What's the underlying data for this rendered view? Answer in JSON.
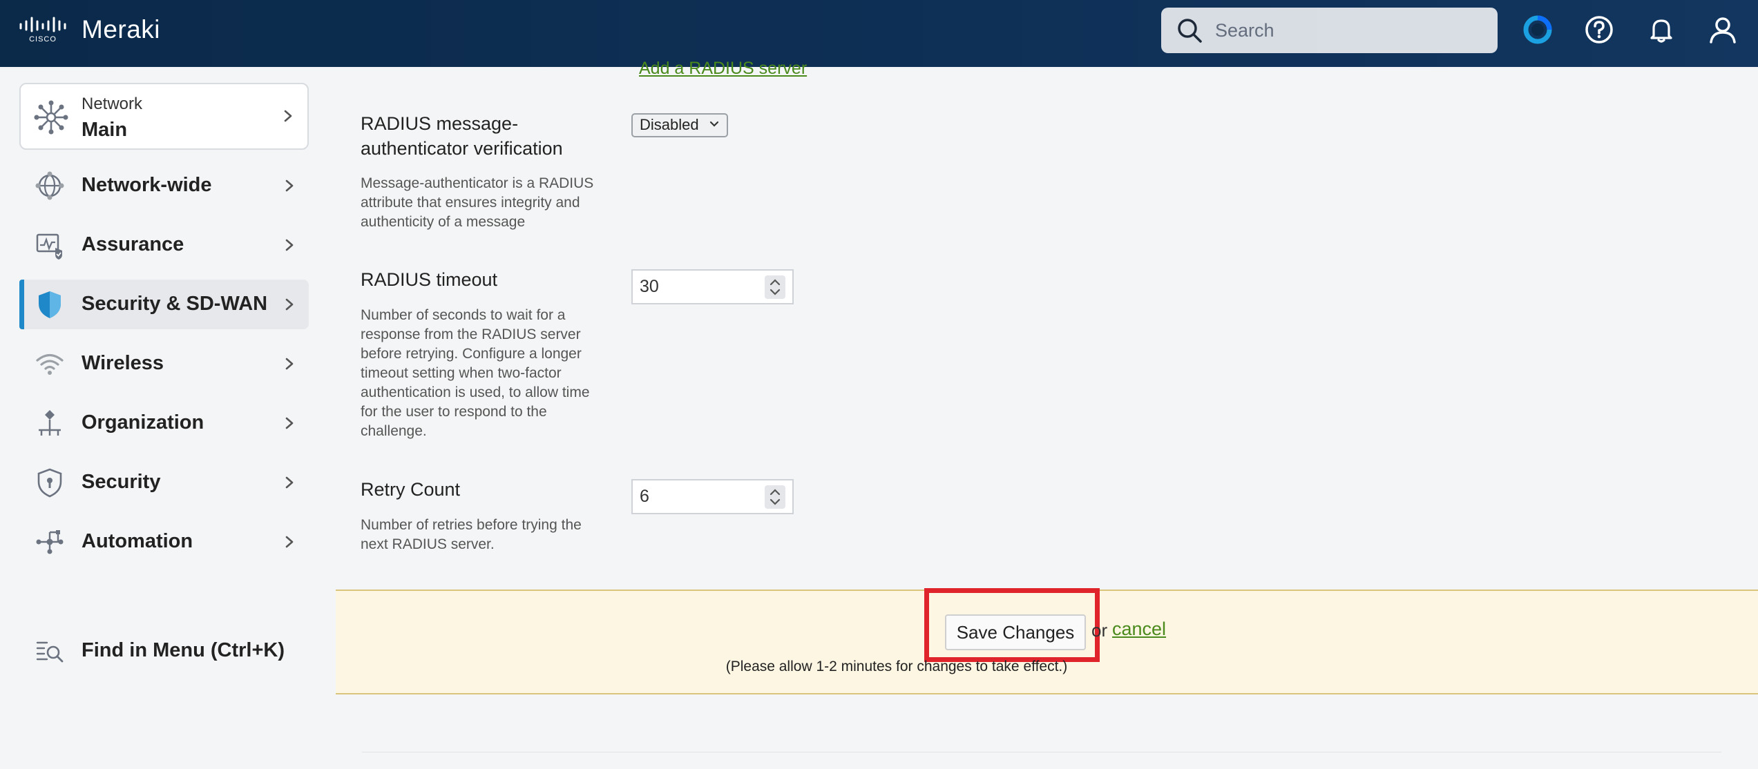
{
  "header": {
    "brand": "Meraki",
    "search_placeholder": "Search"
  },
  "sidebar": {
    "network_label": "Network",
    "network_name": "Main",
    "items": [
      {
        "label": "Network-wide"
      },
      {
        "label": "Assurance"
      },
      {
        "label": "Security & SD-WAN"
      },
      {
        "label": "Wireless"
      },
      {
        "label": "Organization"
      },
      {
        "label": "Security"
      },
      {
        "label": "Automation"
      }
    ],
    "find_menu": "Find in Menu (Ctrl+K)"
  },
  "content": {
    "add_radius_link": "Add a RADIUS server",
    "msg_auth": {
      "title_line1": "RADIUS message-",
      "title_line2": "authenticator verification",
      "desc": "Message-authenticator is a RADIUS attribute that ensures integrity and authenticity of a message",
      "value": "Disabled"
    },
    "timeout": {
      "title": "RADIUS timeout",
      "desc": "Number of seconds to wait for a response from the RADIUS server before retrying. Configure a longer timeout setting when two-factor authentication is used, to allow time for the user to respond to the challenge.",
      "value": "30"
    },
    "retry": {
      "title": "Retry Count",
      "desc": "Number of retries before trying the next RADIUS server.",
      "value": "6"
    },
    "save_bar": {
      "save_label": "Save Changes",
      "or_text": "or",
      "cancel_label": "cancel",
      "note": "(Please allow 1-2 minutes for changes to take effect.)"
    }
  },
  "colors": {
    "header_bg": "#0f3057",
    "link_green": "#4a8a1c",
    "active_accent": "#1e88c9",
    "highlight_red": "#e0242c",
    "save_bar_bg": "#fdf6e2"
  }
}
